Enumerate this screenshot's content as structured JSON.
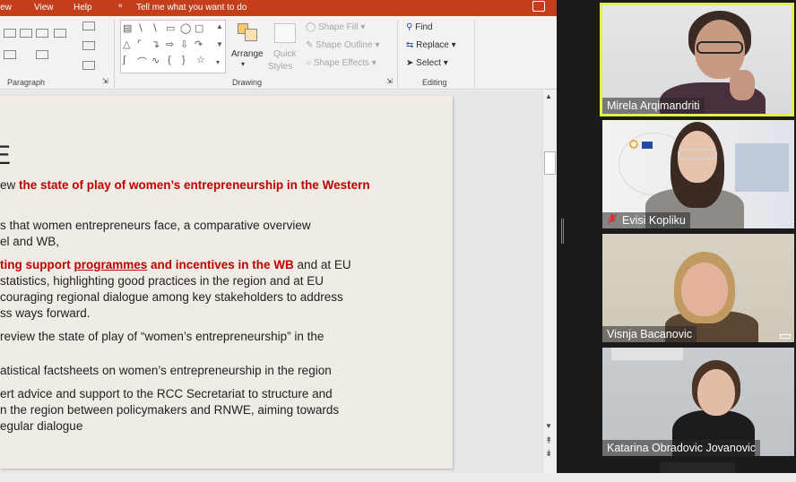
{
  "menubar": {
    "items": [
      "iew",
      "View",
      "Help"
    ],
    "tell_me": "Tell me what you want to do"
  },
  "ribbon": {
    "groups": {
      "paragraph": "Paragraph",
      "drawing": "Drawing",
      "editing": "Editing"
    },
    "arrange": "Arrange",
    "quick_styles": [
      "Quick",
      "Styles"
    ],
    "shape_fill": "Shape Fill",
    "shape_outline": "Shape Outline",
    "shape_effects": "Shape Effects",
    "find": "Find",
    "replace": "Replace",
    "select": "Select"
  },
  "slide": {
    "title": "E",
    "lines": [
      {
        "parts": [
          {
            "t": "ew ",
            "c": "n"
          },
          {
            "t": "the state of play of women’s entrepreneurship in the Western",
            "c": "r"
          }
        ]
      },
      {
        "parts": [
          {
            "t": "s that women entrepreneurs face, a comparative overview",
            "c": "n"
          }
        ]
      },
      {
        "parts": [
          {
            "t": "el and WB,",
            "c": "n"
          }
        ]
      },
      {
        "parts": [
          {
            "t": "ting support ",
            "c": "r"
          },
          {
            "t": "programmes",
            "c": "ru"
          },
          {
            "t": " and incentives in the WB",
            "c": "r"
          },
          {
            "t": " and at EU",
            "c": "n"
          }
        ]
      },
      {
        "parts": [
          {
            "t": " statistics, highlighting good practices in the region and at EU",
            "c": "n"
          }
        ]
      },
      {
        "parts": [
          {
            "t": "couraging regional dialogue among key stakeholders to address",
            "c": "n"
          }
        ]
      },
      {
        "parts": [
          {
            "t": "ss ways forward.",
            "c": "n"
          }
        ]
      },
      {
        "parts": [
          {
            "t": " review the state of play of “women’s entrepreneurship” in the",
            "c": "n"
          }
        ]
      },
      {
        "parts": [
          {
            "t": "atistical factsheets on women’s entrepreneurship in the region",
            "c": "n"
          }
        ]
      },
      {
        "parts": [
          {
            "t": "ert advice and support to the RCC Secretariat to structure and",
            "c": "n"
          }
        ]
      },
      {
        "parts": [
          {
            "t": "n the region between policymakers and RNWE, aiming towards",
            "c": "n"
          }
        ]
      },
      {
        "parts": [
          {
            "t": "egular dialogue",
            "c": "n"
          }
        ]
      }
    ]
  },
  "participants": [
    {
      "name": "Mirela Arqimandriti",
      "active": true,
      "muted": false
    },
    {
      "name": "Evisi Kopliku",
      "active": false,
      "muted": true
    },
    {
      "name": "Visnja Bacanovic",
      "active": false,
      "muted": false
    },
    {
      "name": "Katarina Obradovic Jovanovic",
      "active": false,
      "muted": false
    }
  ],
  "colors": {
    "ppt_accent": "#c43e1c",
    "emphasis_red": "#c00000",
    "active_speaker": "#e3ef4a",
    "muted_mic": "#e03030"
  }
}
